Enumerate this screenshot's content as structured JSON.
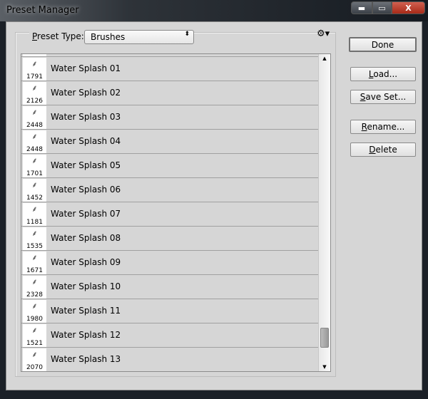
{
  "window": {
    "title": "Preset Manager",
    "min": "▬",
    "max": "▭",
    "close": "X"
  },
  "preset_type": {
    "label_first": "P",
    "label_rest": "reset Type:",
    "value": "Brushes",
    "arrow": "⬍"
  },
  "gear_icon": "⚙▾",
  "items": [
    {
      "size": "",
      "name": ""
    },
    {
      "size": "1791",
      "name": "Water Splash 01"
    },
    {
      "size": "2126",
      "name": "Water Splash 02"
    },
    {
      "size": "2448",
      "name": "Water Splash 03"
    },
    {
      "size": "2448",
      "name": "Water Splash 04"
    },
    {
      "size": "1701",
      "name": "Water Splash 05"
    },
    {
      "size": "1452",
      "name": "Water Splash 06"
    },
    {
      "size": "1181",
      "name": "Water Splash 07"
    },
    {
      "size": "1535",
      "name": "Water Splash 08"
    },
    {
      "size": "1671",
      "name": "Water Splash 09"
    },
    {
      "size": "2328",
      "name": "Water Splash 10"
    },
    {
      "size": "1980",
      "name": "Water Splash 11"
    },
    {
      "size": "1521",
      "name": "Water Splash 12"
    },
    {
      "size": "2070",
      "name": "Water Splash 13"
    }
  ],
  "scrollbar": {
    "position_fraction": 0.97,
    "up": "▲",
    "down": "▼"
  },
  "buttons": {
    "done": "Done",
    "load": {
      "u": "L",
      "rest": "oad..."
    },
    "save": {
      "u": "S",
      "rest": "ave Set..."
    },
    "rename": {
      "u": "R",
      "rest": "ename..."
    },
    "delete": {
      "u": "D",
      "rest": "elete"
    }
  }
}
